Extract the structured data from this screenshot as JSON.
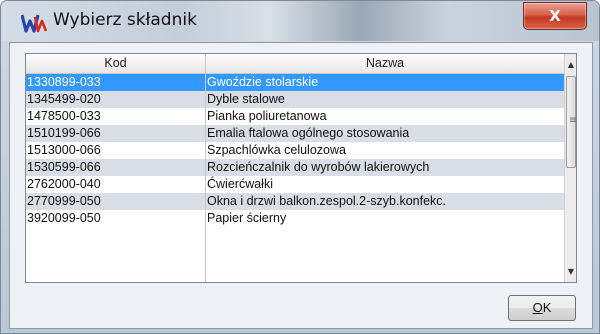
{
  "window": {
    "title": "Wybierz składnik",
    "close_label": "X"
  },
  "list": {
    "columns": {
      "kod": "Kod",
      "nazwa": "Nazwa"
    },
    "rows": [
      {
        "kod": "1330899-033",
        "nazwa": "Gwoździe stolarskie",
        "selected": true
      },
      {
        "kod": "1345499-020",
        "nazwa": "Dyble stalowe"
      },
      {
        "kod": "1478500-033",
        "nazwa": "Pianka poliuretanowa"
      },
      {
        "kod": "1510199-066",
        "nazwa": "Emalia ftalowa ogólnego stosowania"
      },
      {
        "kod": "1513000-066",
        "nazwa": "Szpachlówka celulozowa"
      },
      {
        "kod": "1530599-066",
        "nazwa": "Rozcieńczalnik do wyrobów lakierowych"
      },
      {
        "kod": "2762000-040",
        "nazwa": "Ćwierćwałki"
      },
      {
        "kod": "2770999-050",
        "nazwa": "Okna i drzwi balkon.zespol.2-szyb.konfekc."
      },
      {
        "kod": "3920099-050",
        "nazwa": "Papier ścierny"
      }
    ]
  },
  "buttons": {
    "ok_mnemonic": "O",
    "ok_rest": "K"
  },
  "icons": {
    "app": "app-w-logo-icon",
    "scroll_up": "scroll-up-arrow-icon",
    "scroll_down": "scroll-down-arrow-icon"
  },
  "colors": {
    "selection": "#3399ff",
    "alt_row": "#d9dde6",
    "close_button": "#c23a22"
  }
}
